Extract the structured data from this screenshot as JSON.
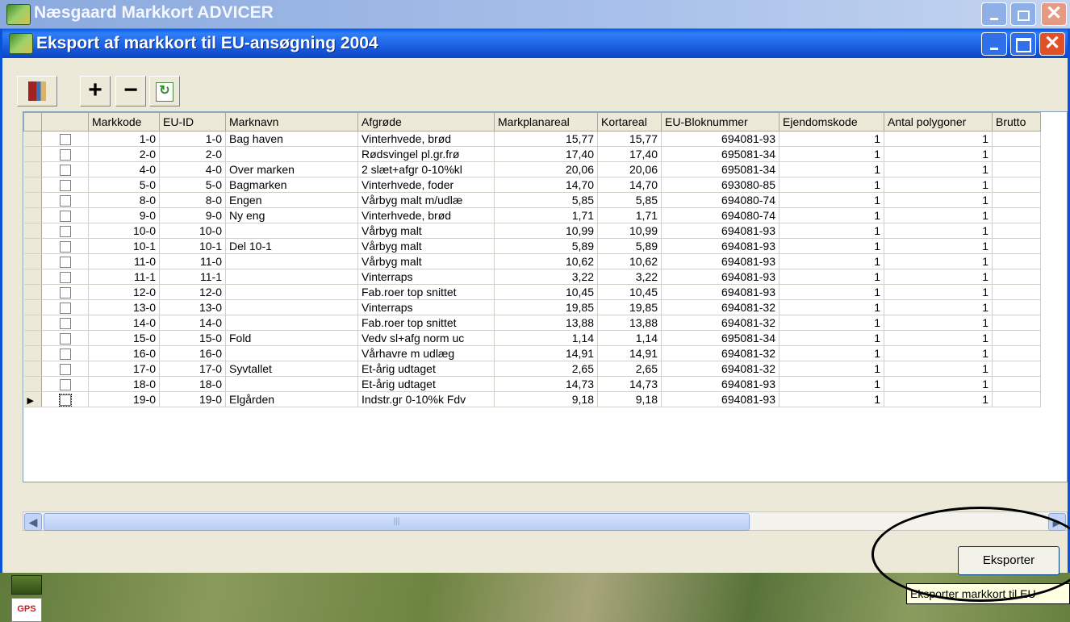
{
  "app": {
    "title": "Næsgaard Markkort ADVICER"
  },
  "window": {
    "title": "Eksport af markkort til EU-ansøgning 2004"
  },
  "toolbar": {
    "add_label": "+",
    "remove_label": "−"
  },
  "table": {
    "columns": [
      "Markkode",
      "EU-ID",
      "Marknavn",
      "Afgrøde",
      "Markplanareal",
      "Kortareal",
      "EU-Bloknummer",
      "Ejendomskode",
      "Antal polygoner",
      "Brutto"
    ],
    "rows": [
      [
        "1-0",
        "1-0",
        "Bag haven",
        "Vinterhvede, brød",
        "15,77",
        "15,77",
        "694081-93",
        "1",
        "1"
      ],
      [
        "2-0",
        "2-0",
        "",
        "Rødsvingel pl.gr.frø",
        "17,40",
        "17,40",
        "695081-34",
        "1",
        "1"
      ],
      [
        "4-0",
        "4-0",
        "Over marken",
        "2 slæt+afgr 0-10%kl",
        "20,06",
        "20,06",
        "695081-34",
        "1",
        "1"
      ],
      [
        "5-0",
        "5-0",
        "Bagmarken",
        "Vinterhvede, foder",
        "14,70",
        "14,70",
        "693080-85",
        "1",
        "1"
      ],
      [
        "8-0",
        "8-0",
        "Engen",
        "Vårbyg malt m/udlæ",
        "5,85",
        "5,85",
        "694080-74",
        "1",
        "1"
      ],
      [
        "9-0",
        "9-0",
        "Ny eng",
        "Vinterhvede, brød",
        "1,71",
        "1,71",
        "694080-74",
        "1",
        "1"
      ],
      [
        "10-0",
        "10-0",
        "",
        "Vårbyg malt",
        "10,99",
        "10,99",
        "694081-93",
        "1",
        "1"
      ],
      [
        "10-1",
        "10-1",
        "Del 10-1",
        "Vårbyg malt",
        "5,89",
        "5,89",
        "694081-93",
        "1",
        "1"
      ],
      [
        "11-0",
        "11-0",
        "",
        "Vårbyg malt",
        "10,62",
        "10,62",
        "694081-93",
        "1",
        "1"
      ],
      [
        "11-1",
        "11-1",
        "",
        "Vinterraps",
        "3,22",
        "3,22",
        "694081-93",
        "1",
        "1"
      ],
      [
        "12-0",
        "12-0",
        "",
        "Fab.roer top snittet",
        "10,45",
        "10,45",
        "694081-93",
        "1",
        "1"
      ],
      [
        "13-0",
        "13-0",
        "",
        "Vinterraps",
        "19,85",
        "19,85",
        "694081-32",
        "1",
        "1"
      ],
      [
        "14-0",
        "14-0",
        "",
        "Fab.roer top snittet",
        "13,88",
        "13,88",
        "694081-32",
        "1",
        "1"
      ],
      [
        "15-0",
        "15-0",
        "Fold",
        "Vedv sl+afg norm uc",
        "1,14",
        "1,14",
        "695081-34",
        "1",
        "1"
      ],
      [
        "16-0",
        "16-0",
        "",
        "Vårhavre m udlæg",
        "14,91",
        "14,91",
        "694081-32",
        "1",
        "1"
      ],
      [
        "17-0",
        "17-0",
        "Syvtallet",
        "Et-årig udtaget",
        "2,65",
        "2,65",
        "694081-32",
        "1",
        "1"
      ],
      [
        "18-0",
        "18-0",
        "",
        "Et-årig udtaget",
        "14,73",
        "14,73",
        "694081-93",
        "1",
        "1"
      ],
      [
        "19-0",
        "19-0",
        "Elgården",
        "Indstr.gr 0-10%k Fdv",
        "9,18",
        "9,18",
        "694081-93",
        "1",
        "1"
      ]
    ]
  },
  "actions": {
    "export_label": "Eksporter"
  },
  "tooltip": {
    "text": "Eksporter markkort til EU"
  },
  "taskbar": {
    "gps_label": "GPS"
  },
  "colors": {
    "titlebar_blue": "#0a5ce6",
    "close_red": "#e2502a",
    "annotation": "#000000"
  }
}
